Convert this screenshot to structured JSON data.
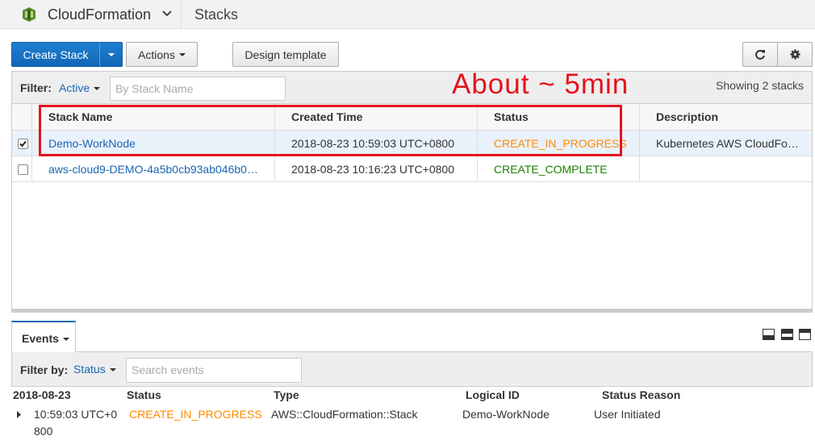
{
  "topbar": {
    "service_name": "CloudFormation",
    "page_title": "Stacks",
    "icon": "cloudformation-icon",
    "brand_color": "#5a8a2c"
  },
  "toolbar": {
    "create_stack_label": "Create Stack",
    "actions_label": "Actions",
    "design_template_label": "Design template",
    "refresh_icon": "refresh-icon",
    "settings_icon": "gear-icon"
  },
  "filter": {
    "label": "Filter:",
    "value": "Active",
    "placeholder": "By Stack Name",
    "showing": "Showing 2 stacks"
  },
  "table": {
    "headers": [
      "Stack Name",
      "Created Time",
      "Status",
      "Description"
    ],
    "rows": [
      {
        "selected": true,
        "name": "Demo-WorkNode",
        "created": "2018-08-23 10:59:03 UTC+0800",
        "status": "CREATE_IN_PROGRESS",
        "description": "Kubernetes AWS CloudFor…"
      },
      {
        "selected": false,
        "name": "aws-cloud9-DEMO-4a5b0cb93ab046b0a…",
        "created": "2018-08-23 10:16:23 UTC+0800",
        "status": "CREATE_COMPLETE",
        "description": ""
      }
    ]
  },
  "annotation": {
    "text": "About ~ 5min",
    "color": "#e3141d"
  },
  "events": {
    "tab_label": "Events",
    "filter_label": "Filter by:",
    "filter_value": "Status",
    "search_placeholder": "Search events",
    "headers": {
      "date": "2018-08-23",
      "status": "Status",
      "type": "Type",
      "logical_id": "Logical ID",
      "reason": "Status Reason"
    },
    "rows": [
      {
        "time_line1": "10:59:03 UTC+0",
        "time_line2": "800",
        "status": "CREATE_IN_PROGRESS",
        "type": "AWS::CloudFormation::Stack",
        "logical_id": "Demo-WorkNode",
        "reason": "User Initiated"
      }
    ]
  },
  "colors": {
    "link": "#1b66b3",
    "in_progress": "#ff8a00",
    "complete": "#1d8102",
    "primary_button": "#1266b6"
  }
}
